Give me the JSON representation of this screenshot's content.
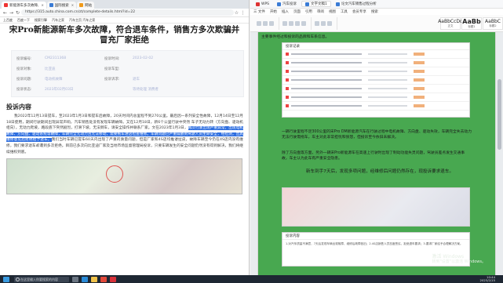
{
  "browser": {
    "tabs": [
      {
        "label": "新能源车多次故障,",
        "fav_color": "#e33"
      },
      {
        "label": "国际搜索",
        "fav_color": "#3a7bd5"
      },
      {
        "label": "网站",
        "fav_color": "#f09a1a"
      }
    ],
    "url": "https://315.auto.china.com.cn/zt/complete-details.html?id=22",
    "bookmarks": [
      "上百度",
      "百度一下",
      "搜索引擎",
      "汽车之家",
      "汽车主页 汽车之家"
    ],
    "article": {
      "title": "宋Pro新能源新车多次故障，符合退车条件，销售方多次欺骗并冒充厂家拒绝",
      "info": [
        {
          "label": "投诉编号:",
          "value": "CM2311368",
          "label2": "投诉时间:",
          "value2": "2023-02-02"
        },
        {
          "label": "投诉对象:",
          "value": "比亚迪",
          "label2": "投诉车型:",
          "value2": ""
        },
        {
          "label": "投诉问题:",
          "value": "电动机故障",
          "label2": "投诉诉求:",
          "value2": "退车"
        },
        {
          "label": "投诉状态:",
          "value": "2023年02月03日",
          "label2": "",
          "value2": "等待处理  消费者"
        }
      ],
      "section_heading": "投诉内容",
      "body_pre": "我2022年12月13日提车，至2023年1月3日和提车后故障，20天时间内总里程不到270公里。最后因一系列安全性故障，12月14日至12月18日使用，期间行驶期间出现异常声响，汽车销售处没有发现车辆故障。又在12月18日，新6个公里行驶中突然 车子无动力转（方向盘、驱动机组向），无动力爬坡，路段底下突然剧烈，打滑下坡，无法倒车，请安全操作并联系厂家。文在2023年1月3日，",
      "body_hl": "再次行驶出现严重异常，出现电机故障、方向盘、驱动系统等故障，车辆完全无动力且无法移动，需要拖车进店检查维修。车辆问题已严重威胁到驾驶人员生命安全，经检测，出具维修意见后拒绝给予退车。",
      "body_post": "我们当时车辆已提车60天内出现了严重的质量问题，但是厂家和4S店均推诿扯皮，故障车辆至今仍在4S店内没有维修，我们要求退车却遭到多次拒绝。目前已多次向比亚迪厂家及当地市场监督管理局投诉，只要车辆发生的安全问题仍然没有得到解决，我们将继续维权到底。"
    }
  },
  "word": {
    "tabs": [
      {
        "label": "WPS",
        "color": "#d33"
      },
      {
        "label": "汽车投诉",
        "color": "#3a7bd5"
      },
      {
        "label": "文字文稿1",
        "color": "#3a7bd5"
      },
      {
        "label": "论文汽车销售过程分析",
        "color": "#3a7bd5"
      }
    ],
    "menu": [
      "三 文件",
      "开始",
      "插入",
      "页面",
      "引用",
      "审阅",
      "视图",
      "工具",
      "会员专享",
      "搜索"
    ],
    "styles": [
      {
        "s1": "AaBbCcDd",
        "s2": "正文",
        "big": false
      },
      {
        "s1": "AaBb",
        "s2": "标题1",
        "big": true
      },
      {
        "s1": "AaBbC",
        "s2": "标题2",
        "big": false
      }
    ],
    "doc_heading": "主要事件经过和投诉的品牌和车系信息。",
    "card1_title": "投诉记录",
    "card2_title": "投诉内容",
    "paragraph_1": "一辆行驶里程不足300公里的宋Pro DM新能源汽车在行驶过程中电机故障、方向盘、驱动失效，车辆完全失去动力无法行驶需拖车，车主对此非常担忧和愤怒，但投诉至今依旧未解决。",
    "paragraph_2": "除了方向盘等方面，另外一辆宋Pro新能源车在高速上行驶时出现了制动功能失灵问题，驾驶员差点发生交通事故，车主认为此车有严重安全隐患。",
    "paragraph_3": "新车到手7天后，发现多项问题，经维修后问题仍然存在，现投诉要求退车。",
    "card3_title": "投诉内容",
    "card3_text": "1.对汽车质量不满意，7天后发现车辆出现故障，维修后故障依旧；2.4S店销售人员态度恶劣，拒绝退车要求；3.要求厂家给予合理解决方案。",
    "watermark_1": "激活 Windows",
    "watermark_2": "转到\"设置\"以激活 Windows。"
  },
  "taskbar": {
    "search_placeholder": "在这里输入你要搜索的内容",
    "time": "10:44",
    "date": "2023/2/15"
  }
}
